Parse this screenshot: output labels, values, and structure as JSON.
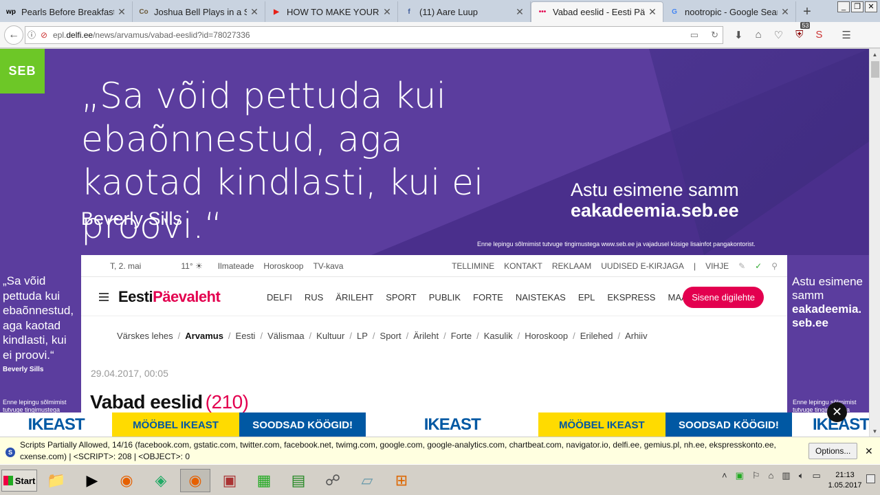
{
  "browser": {
    "tabs": [
      {
        "title": "Pearls Before Breakfast: C",
        "fav": "wp",
        "fav_color": "#000000"
      },
      {
        "title": "Joshua Bell Plays in a Sub",
        "fav": "Co",
        "fav_color": "#6b5a3a"
      },
      {
        "title": "HOW TO MAKE YOUR TE",
        "fav": "▶",
        "fav_color": "#e62117"
      },
      {
        "title": "(11) Aare Luup",
        "fav": "f",
        "fav_color": "#3b5998"
      },
      {
        "title": "Vabad eeslid - Eesti Päeva",
        "fav": "•••",
        "fav_color": "#e3004f"
      },
      {
        "title": "nootropic - Google Searc",
        "fav": "G",
        "fav_color": "#4285f4"
      }
    ],
    "new_tab": "+",
    "url_prefix": "epl.",
    "url_domain": "delfi.ee",
    "url_path": "/news/arvamus/vabad-eeslid?id=78027336",
    "badge_count": "53"
  },
  "ad": {
    "brand": "SEB",
    "quote": "„Sa võid pettuda kui ebaõnnestud, aga kaotad kindlasti, kui ei proovi.“",
    "author": "Beverly Sills",
    "cta_line1": "Astu esimene samm",
    "cta_line2": "eakadeemia.seb.ee",
    "disclaimer": "Enne lepingu sõlmimist tutvuge tingimustega www.seb.ee ja vajadusel küsige lisainfot pangakontorist.",
    "side_left_quote": "„Sa võid pettuda kui ebaõnnestud, aga kaotad kindlasti, kui ei proovi.“",
    "side_left_author": "Beverly Sills",
    "side_left_foot": "Enne lepingu sõlmimist tutvuge tingimustega",
    "side_right_line1": "Astu esimene samm",
    "side_right_line2": "eakadeemia. seb.ee",
    "side_right_foot": "Enne lepingu sõlmimist tutvuge tingimustega"
  },
  "site": {
    "date_today": "T, 2. mai",
    "weather": "11° ☀",
    "top_links": [
      "Ilmateade",
      "Horoskoop",
      "TV-kava"
    ],
    "right_links": [
      "TELLIMINE",
      "KONTAKT",
      "REKLAAM",
      "UUDISED E-KIRJAGA",
      "|",
      "VIHJE"
    ],
    "logo_a": "Eesti",
    "logo_b": "Päevaleht",
    "nav": [
      "DELFI",
      "RUS",
      "ÄRILEHT",
      "SPORT",
      "PUBLIK",
      "FORTE",
      "NAISTEKAS",
      "EPL",
      "EKSPRESS",
      "MAALEHT"
    ],
    "cta": "Sisene digilehte",
    "crumbs": [
      "Värskes lehes",
      "Arvamus",
      "Eesti",
      "Välismaa",
      "Kultuur",
      "LP",
      "Sport",
      "Ärileht",
      "Forte",
      "Kasulik",
      "Horoskoop",
      "Erilehed",
      "Arhiiv"
    ],
    "article_date": "29.04.2017, 00:05",
    "headline": "Vabad eeslid",
    "comments": "(210)"
  },
  "ikea": {
    "logo": "IKEAST",
    "yellow": "MÖÖBEL IKEAST",
    "blue": "SOODSAD KÖÖGID!"
  },
  "noscript": {
    "message": "Scripts Partially Allowed, 14/16 (facebook.com, gstatic.com, twitter.com, facebook.net, twimg.com, google.com, google-analytics.com, chartbeat.com, navigator.io, delfi.ee, gemius.pl, nh.ee, ekspresskonto.ee, cxense.com) | <SCRIPT>: 208 | <OBJECT>: 0",
    "options": "Options...",
    "close": "✕"
  },
  "taskbar": {
    "start": "Start",
    "time": "21:13",
    "date": "1.05.2017"
  }
}
